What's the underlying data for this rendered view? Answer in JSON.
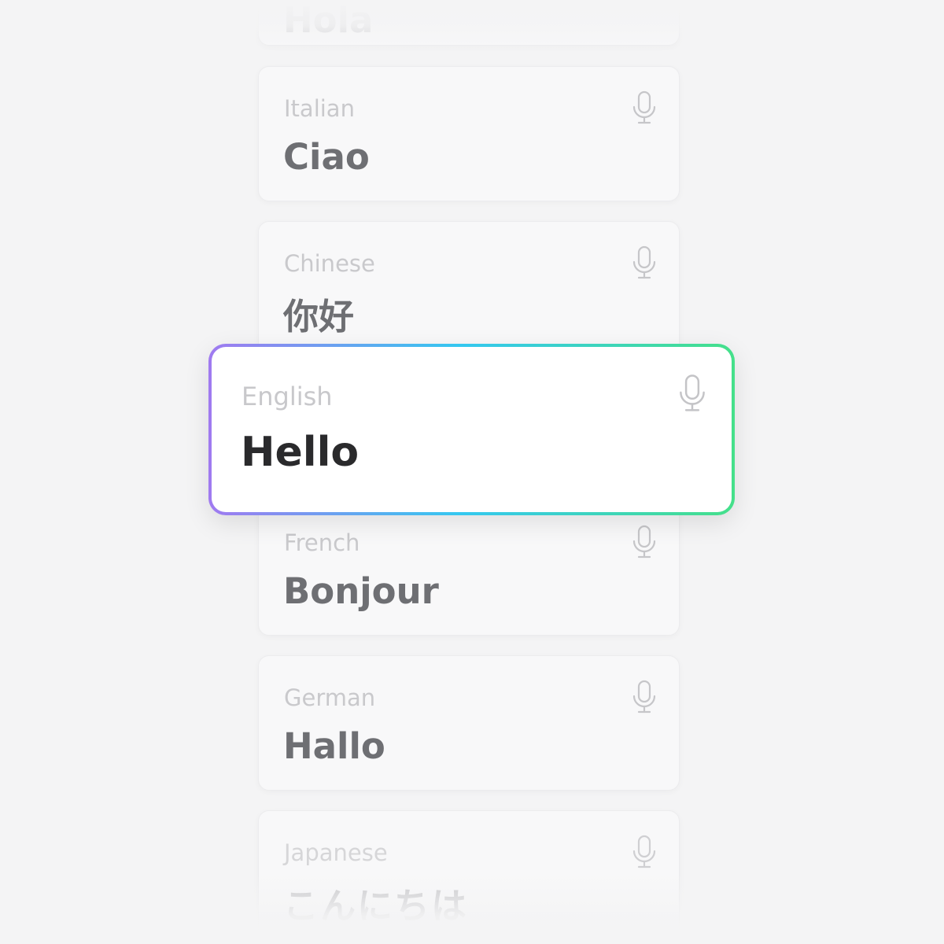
{
  "cards": [
    {
      "id": "top",
      "language": "",
      "greeting": "Hola"
    },
    {
      "id": "italian",
      "language": "Italian",
      "greeting": "Ciao"
    },
    {
      "id": "chinese",
      "language": "Chinese",
      "greeting": "你好"
    },
    {
      "id": "french",
      "language": "French",
      "greeting": "Bonjour"
    },
    {
      "id": "german",
      "language": "German",
      "greeting": "Hallo"
    },
    {
      "id": "japanese",
      "language": "Japanese",
      "greeting": "こんにちは"
    }
  ],
  "active": {
    "language": "English",
    "greeting": "Hello"
  },
  "icons": {
    "mic": "microphone-icon"
  },
  "colors": {
    "gradient_start": "#a07af0",
    "gradient_mid": "#34c8f0",
    "gradient_end": "#45e08a"
  }
}
